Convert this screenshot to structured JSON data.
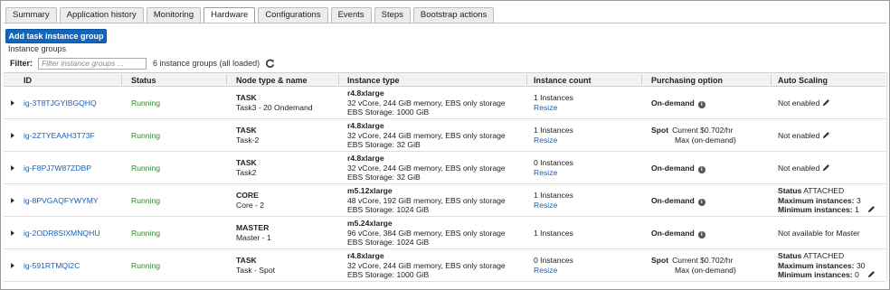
{
  "tabs": [
    "Summary",
    "Application history",
    "Monitoring",
    "Hardware",
    "Configurations",
    "Events",
    "Steps",
    "Bootstrap actions"
  ],
  "active_tab": "Hardware",
  "add_button_label": "Add task instance group",
  "section_label": "Instance groups",
  "filter": {
    "label": "Filter:",
    "placeholder": "Filter instance groups ...",
    "count_text": "6 instance groups (all loaded)"
  },
  "columns": [
    "ID",
    "Status",
    "Node type & name",
    "Instance type",
    "Instance count",
    "Purchasing option",
    "Auto Scaling"
  ],
  "rows": [
    {
      "id": "ig-3T8TJGYIBGQHQ",
      "status": "Running",
      "node_type": "TASK",
      "node_name": "Task3 - 20 Ondemand",
      "instance_type": "r4.8xlarge",
      "specs": "32 vCore, 244 GiB memory, EBS only storage",
      "ebs": "EBS Storage:   1000 GiB",
      "count": "1 Instances",
      "resize": "Resize",
      "purchasing": "On-demand",
      "purchasing_kind": "ondemand",
      "auto_scaling": [
        "Not enabled"
      ],
      "auto_scaling_kind": "simple"
    },
    {
      "id": "ig-2ZTYEAAH3T73F",
      "status": "Running",
      "node_type": "TASK",
      "node_name": "Task-2",
      "instance_type": "r4.8xlarge",
      "specs": "32 vCore, 244 GiB memory, EBS only storage",
      "ebs": "EBS Storage:   32 GiB",
      "count": "1 Instances",
      "resize": "Resize",
      "purchasing": "Spot",
      "spot_line1": "Current $0.702/hr",
      "spot_line2": "Max (on-demand)",
      "purchasing_kind": "spot",
      "auto_scaling": [
        "Not enabled"
      ],
      "auto_scaling_kind": "simple"
    },
    {
      "id": "ig-F8PJ7W87ZDBP",
      "status": "Running",
      "node_type": "TASK",
      "node_name": "Task2",
      "instance_type": "r4.8xlarge",
      "specs": "32 vCore, 244 GiB memory, EBS only storage",
      "ebs": "EBS Storage:   32 GiB",
      "count": "0 Instances",
      "resize": "Resize",
      "purchasing": "On-demand",
      "purchasing_kind": "ondemand",
      "auto_scaling": [
        "Not enabled"
      ],
      "auto_scaling_kind": "simple"
    },
    {
      "id": "ig-8PVGAQFYWYMY",
      "status": "Running",
      "node_type": "CORE",
      "node_name": "Core - 2",
      "instance_type": "m5.12xlarge",
      "specs": "48 vCore, 192 GiB memory, EBS only storage",
      "ebs": "EBS Storage:   1024 GiB",
      "count": "1 Instances",
      "resize": "Resize",
      "purchasing": "On-demand",
      "purchasing_kind": "ondemand",
      "auto_scaling": [
        {
          "label": "Status",
          "value": "ATTACHED"
        },
        {
          "label": "Maximum instances:",
          "value": "3"
        },
        {
          "label": "Minimum instances:",
          "value": "1"
        }
      ],
      "auto_scaling_kind": "detail"
    },
    {
      "id": "ig-2ODR8SIXMNQHU",
      "status": "Running",
      "node_type": "MASTER",
      "node_name": "Master - 1",
      "instance_type": "m5.24xlarge",
      "specs": "96 vCore, 384 GiB memory, EBS only storage",
      "ebs": "EBS Storage:   1024 GiB",
      "count": "1 Instances",
      "resize": "",
      "purchasing": "On-demand",
      "purchasing_kind": "ondemand",
      "auto_scaling": [
        "Not available for Master"
      ],
      "auto_scaling_kind": "plain"
    },
    {
      "id": "ig-591RTMQI2C",
      "status": "Running",
      "node_type": "TASK",
      "node_name": "Task - Spot",
      "instance_type": "r4.8xlarge",
      "specs": "32 vCore, 244 GiB memory, EBS only storage",
      "ebs": "EBS Storage:   1000 GiB",
      "count": "0 Instances",
      "resize": "Resize",
      "purchasing": "Spot",
      "spot_line1": "Current $0.702/hr",
      "spot_line2": "Max (on-demand)",
      "purchasing_kind": "spot",
      "auto_scaling": [
        {
          "label": "Status",
          "value": "ATTACHED"
        },
        {
          "label": "Maximum instances:",
          "value": "30"
        },
        {
          "label": "Minimum instances:",
          "value": "0"
        }
      ],
      "auto_scaling_kind": "detail"
    }
  ],
  "icons": {
    "refresh": "refresh-icon",
    "expand": "triangle-right-icon",
    "info": "info-icon",
    "edit": "pencil-icon"
  },
  "colors": {
    "link": "#1a5fb4",
    "running": "#2a8a2a",
    "button": "#1166bb"
  }
}
